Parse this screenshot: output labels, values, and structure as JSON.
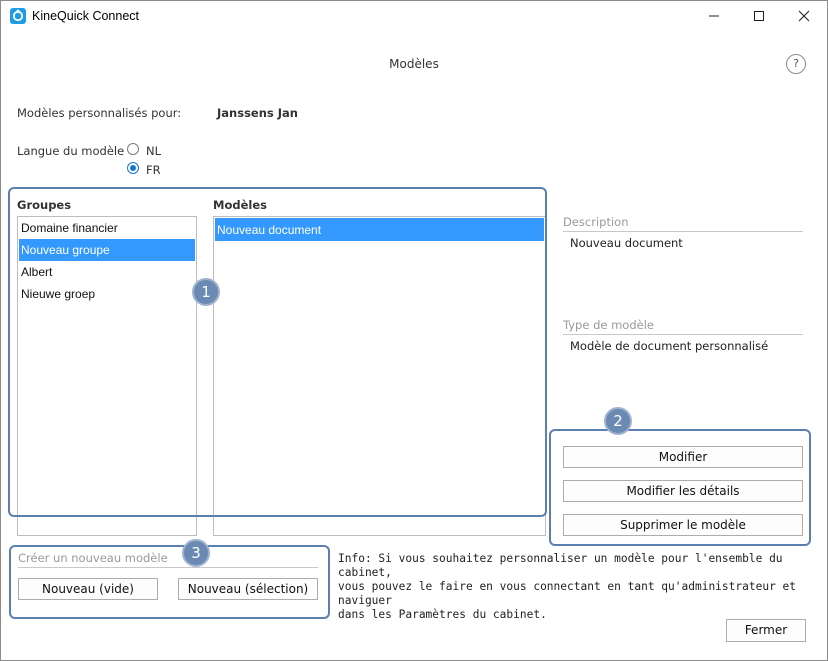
{
  "window": {
    "title": "KineQuick Connect"
  },
  "page": {
    "title": "Modèles",
    "help_glyph": "?"
  },
  "customized_for": {
    "label": "Modèles personnalisés pour:",
    "value": "Janssens Jan"
  },
  "language": {
    "label": "Langue du modèle",
    "options": [
      {
        "label": "NL",
        "checked": false
      },
      {
        "label": "FR",
        "checked": true
      }
    ]
  },
  "groups": {
    "header": "Groupes",
    "items": [
      "Domaine financier",
      "Nouveau groupe",
      "Albert",
      "Nieuwe groep"
    ],
    "selected_index": 1
  },
  "models": {
    "header": "Modèles",
    "items": [
      "Nouveau document"
    ],
    "selected_index": 0
  },
  "details": {
    "description_label": "Description",
    "description_value": "Nouveau document",
    "type_label": "Type de modèle",
    "type_value": "Modèle de document personnalisé"
  },
  "actions": {
    "modify": "Modifier",
    "modify_details": "Modifier les détails",
    "delete_model": "Supprimer le modèle"
  },
  "create": {
    "label": "Créer un nouveau modèle",
    "new_empty": "Nouveau (vide)",
    "new_selection": "Nouveau (sélection)"
  },
  "info_text": [
    "Info: Si vous souhaitez personnaliser un modèle pour l'ensemble du cabinet,",
    "vous pouvez le faire en vous connectant en tant qu'administrateur et naviguer",
    "dans les Paramètres du cabinet."
  ],
  "footer": {
    "close": "Fermer"
  },
  "callouts": [
    "1",
    "2",
    "3"
  ],
  "colors": {
    "selection": "#3399ff",
    "callout": "#5b7fb0",
    "radio_accent": "#1a73d9"
  }
}
